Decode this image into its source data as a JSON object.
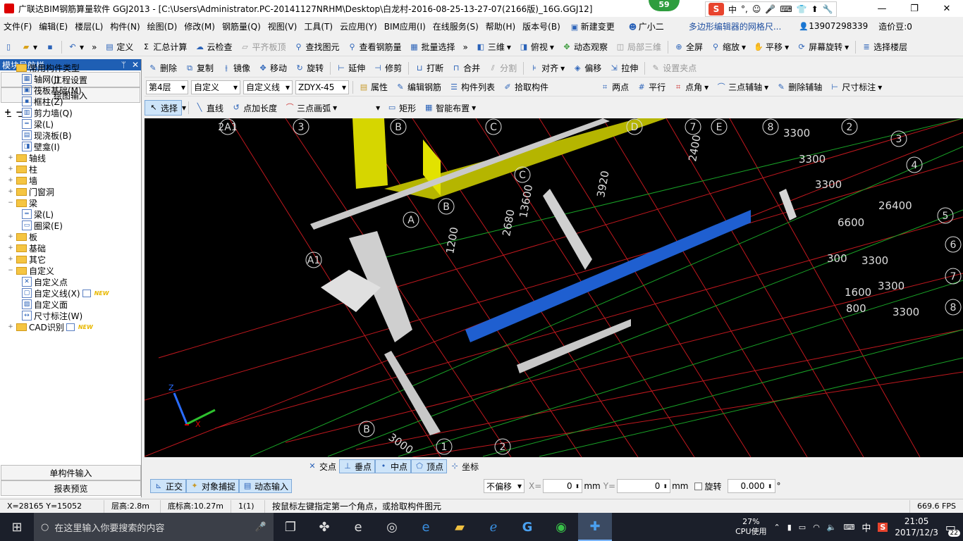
{
  "window": {
    "title": "广联达BIM钢筋算量软件 GGJ2013 - [C:\\Users\\Administrator.PC-20141127NRHM\\Desktop\\白龙村-2016-08-25-13-27-07(2166版)_16G.GGJ12]",
    "badge": "59",
    "minimize": "—",
    "restore": "❐",
    "close": "✕"
  },
  "ime": {
    "s": "S",
    "items": [
      "中",
      "°,",
      "☺",
      "🎤",
      "⌨",
      "👕",
      "⬆",
      "🔧"
    ]
  },
  "menu": {
    "items": [
      "文件(F)",
      "编辑(E)",
      "楼层(L)",
      "构件(N)",
      "绘图(D)",
      "修改(M)",
      "钢筋量(Q)",
      "视图(V)",
      "工具(T)",
      "云应用(Y)",
      "BIM应用(I)",
      "在线服务(S)",
      "帮助(H)",
      "版本号(B)",
      "新建变更",
      "广小二",
      "多边形编辑器的网格尺...",
      "13907298339",
      "造价豆:0"
    ]
  },
  "toolbar1": {
    "items": [
      "定义",
      "汇总计算",
      "云检查",
      "平齐板顶",
      "查找图元",
      "查看钢筋量",
      "批量选择",
      "三维",
      "俯视",
      "动态观察",
      "局部三维",
      "全屏",
      "缩放",
      "平移",
      "屏幕旋转",
      "选择楼层"
    ]
  },
  "toolbar2": {
    "items": [
      "删除",
      "复制",
      "镜像",
      "移动",
      "旋转",
      "延伸",
      "修剪",
      "打断",
      "合并",
      "分割",
      "对齐",
      "偏移",
      "拉伸",
      "设置夹点"
    ]
  },
  "toolbar3": {
    "floor": "第4层",
    "type1": "自定义",
    "type2": "自定义线",
    "code": "ZDYX-45",
    "items": [
      "属性",
      "编辑钢筋",
      "构件列表",
      "拾取构件"
    ],
    "right": [
      "两点",
      "平行",
      "点角",
      "三点辅轴",
      "删除辅轴",
      "尺寸标注"
    ]
  },
  "toolbar4": {
    "items": [
      "选择",
      "直线",
      "点加长度",
      "三点画弧",
      "矩形",
      "智能布置"
    ]
  },
  "sidebar": {
    "title": "模块导航栏",
    "pin": "ᛘ",
    "close": "✕",
    "btn1": "工程设置",
    "btn2": "绘图输入",
    "foot1": "单构件输入",
    "foot2": "报表预览"
  },
  "tree": [
    {
      "lvl": 0,
      "exp": "−",
      "kind": "folder",
      "label": "常用构件类型"
    },
    {
      "lvl": 1,
      "kind": "item",
      "icon": "▦",
      "label": "轴网(J)"
    },
    {
      "lvl": 1,
      "kind": "item",
      "icon": "▣",
      "label": "筏板基础(M)"
    },
    {
      "lvl": 1,
      "kind": "item",
      "icon": "▪",
      "label": "框柱(Z)"
    },
    {
      "lvl": 1,
      "kind": "item",
      "icon": "▥",
      "label": "剪力墙(Q)"
    },
    {
      "lvl": 1,
      "kind": "item",
      "icon": "═",
      "label": "梁(L)"
    },
    {
      "lvl": 1,
      "kind": "item",
      "icon": "▤",
      "label": "现浇板(B)"
    },
    {
      "lvl": 1,
      "kind": "item",
      "icon": "◨",
      "label": "壁龛(I)"
    },
    {
      "lvl": 0,
      "exp": "+",
      "kind": "folder",
      "label": "轴线"
    },
    {
      "lvl": 0,
      "exp": "+",
      "kind": "folder",
      "label": "柱"
    },
    {
      "lvl": 0,
      "exp": "+",
      "kind": "folder",
      "label": "墙"
    },
    {
      "lvl": 0,
      "exp": "+",
      "kind": "folder",
      "label": "门窗洞"
    },
    {
      "lvl": 0,
      "exp": "−",
      "kind": "folder",
      "label": "梁"
    },
    {
      "lvl": 1,
      "kind": "item",
      "icon": "═",
      "label": "梁(L)"
    },
    {
      "lvl": 1,
      "kind": "item",
      "icon": "▭",
      "label": "圈梁(E)"
    },
    {
      "lvl": 0,
      "exp": "+",
      "kind": "folder",
      "label": "板"
    },
    {
      "lvl": 0,
      "exp": "+",
      "kind": "folder",
      "label": "基础"
    },
    {
      "lvl": 0,
      "exp": "+",
      "kind": "folder",
      "label": "其它"
    },
    {
      "lvl": 0,
      "exp": "−",
      "kind": "folder",
      "label": "自定义"
    },
    {
      "lvl": 1,
      "kind": "item",
      "icon": "✕",
      "label": "自定义点"
    },
    {
      "lvl": 1,
      "kind": "item",
      "icon": "▢",
      "label": "自定义线(X)",
      "new": "NEW"
    },
    {
      "lvl": 1,
      "kind": "item",
      "icon": "▨",
      "label": "自定义面"
    },
    {
      "lvl": 1,
      "kind": "item",
      "icon": "↔",
      "label": "尺寸标注(W)"
    },
    {
      "lvl": 0,
      "exp": "+",
      "kind": "folder",
      "label": "CAD识别",
      "new": "NEW"
    }
  ],
  "viewport": {
    "axis_labels": {
      "top": [
        "2A1",
        "3",
        "B",
        "C",
        "D",
        "7",
        "E",
        "8",
        "2"
      ],
      "right": [
        "3",
        "4",
        "5",
        "6",
        "7",
        "8"
      ],
      "inner": [
        "C",
        "B",
        "A",
        "A1",
        "B",
        "1",
        "2"
      ]
    },
    "dims": [
      "3300",
      "3300",
      "3300",
      "26400",
      "6600",
      "300",
      "3300",
      "1600",
      "3300",
      "800",
      "3300",
      "2400",
      "3920",
      "13600",
      "2680",
      "1200",
      "3000"
    ],
    "triad": {
      "z": "Z",
      "x": "X"
    }
  },
  "snap": {
    "items": [
      "交点",
      "垂点",
      "中点",
      "顶点",
      "坐标"
    ]
  },
  "bottom": {
    "items": [
      "正交",
      "对象捕捉",
      "动态输入"
    ],
    "offset": "不偏移",
    "xlabel": "X=",
    "xval": "0",
    "ylabel": "Y=",
    "yval": "0",
    "unit": "mm",
    "rotate": "旋转",
    "rotval": "0.000",
    "deg": "°"
  },
  "status": {
    "coord": "X=28165 Y=15052",
    "height": "层高:2.8m",
    "base": "底标高:10.27m",
    "count": "1(1)",
    "hint": "按鼠标左键指定第一个角点，或拾取构件图元",
    "fps": "669.6 FPS"
  },
  "taskbar": {
    "search": "在这里输入你要搜索的内容",
    "cpu": "27%",
    "cpu_label": "CPU使用",
    "lang": "中",
    "time": "21:05",
    "date": "2017/12/3",
    "notif": "22"
  }
}
